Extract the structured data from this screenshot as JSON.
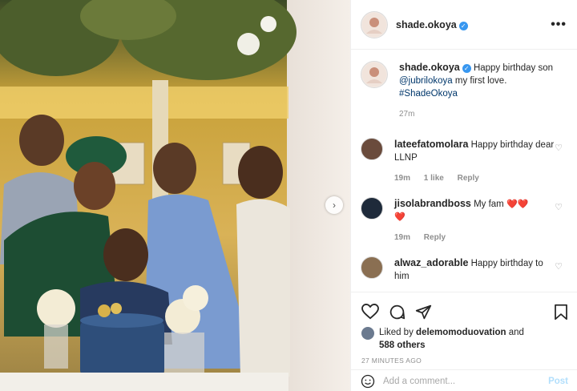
{
  "header": {
    "username": "shade.okoya",
    "more_label": "•••"
  },
  "caption": {
    "username": "shade.okoya",
    "text_1": "Happy birthday son",
    "mention": "@jubrilokoya",
    "text_2": "my first love.",
    "hashtag": "#ShadeOkoya",
    "time": "27m"
  },
  "comments": [
    {
      "username": "lateefatomolara",
      "text": "Happy birthday dear LLNP",
      "time": "19m",
      "likes": "1 like",
      "reply": "Reply"
    },
    {
      "username": "jisolabrandboss",
      "text": "My fam",
      "time": "19m",
      "reply": "Reply"
    },
    {
      "username": "alwaz_adorable",
      "text": "Happy birthday to him"
    }
  ],
  "likes": {
    "prefix": "Liked by",
    "user": "delemomoduovation",
    "and": "and",
    "others": "588 others"
  },
  "post_time": "27 MINUTES AGO",
  "add_comment": {
    "placeholder": "Add a comment...",
    "post_label": "Post"
  },
  "colors": {
    "link": "#00376b",
    "verified": "#3897f0",
    "heart": "#e0245e",
    "secondary_text": "#8e8e8e"
  },
  "icons": [
    "heart-icon",
    "comment-icon",
    "share-icon",
    "bookmark-icon",
    "chevron-right-icon",
    "more-icon",
    "verified-badge-icon",
    "emoji-icon"
  ]
}
